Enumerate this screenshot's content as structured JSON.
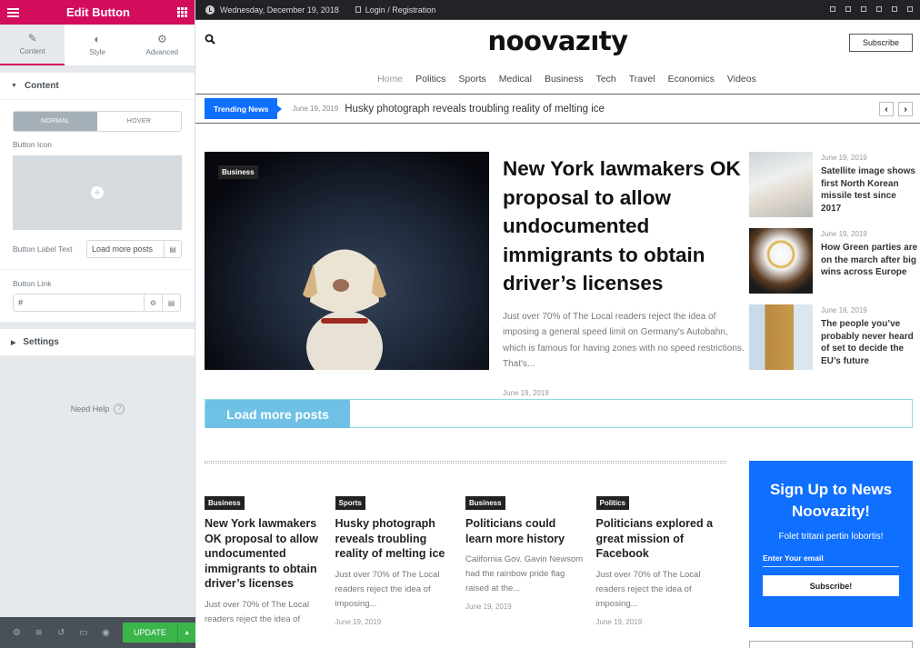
{
  "editor": {
    "title": "Edit Button",
    "tabs": [
      {
        "label": "Content",
        "icon": "pencil-icon",
        "active": true
      },
      {
        "label": "Style",
        "icon": "contrast-icon",
        "active": false
      },
      {
        "label": "Advanced",
        "icon": "gear-icon",
        "active": false
      }
    ],
    "content_section": "Content",
    "state_toggle": {
      "normal": "NORMAL",
      "hover": "HOVER",
      "selected": "NORMAL"
    },
    "button_icon_label": "Button Icon",
    "button_label_text_label": "Button Label Text",
    "button_label_text_value": "Load more posts",
    "button_link_label": "Button Link",
    "button_link_value": "#",
    "settings_section": "Settings",
    "need_help": "Need Help",
    "update_label": "UPDATE"
  },
  "site": {
    "topbar": {
      "date": "Wednesday, December 19, 2018",
      "login": "Login / Registration"
    },
    "logo": "noovazıty",
    "subscribe_label": "Subscribe",
    "nav": [
      "Home",
      "Politics",
      "Sports",
      "Medical",
      "Business",
      "Tech",
      "Travel",
      "Economics",
      "Videos"
    ],
    "trending": {
      "badge": "Trending News",
      "date": "June 19, 2019",
      "title": "Husky photograph reveals troubling reality of melting ice"
    },
    "hero": {
      "category": "Business",
      "title": "New York lawmakers OK proposal to allow undocumented immigrants to obtain driver’s licenses",
      "excerpt": "Just over 70% of The Local readers reject the idea of imposing a general speed limit on Germany's Autobahn, which is famous for having zones with no speed restrictions. That's...",
      "date": "June 19, 2019"
    },
    "side_posts": [
      {
        "date": "June 19, 2019",
        "title": "Satellite image shows first North Korean missile test since 2017"
      },
      {
        "date": "June 19, 2019",
        "title": "How Green parties are on the march after big wins across Europe"
      },
      {
        "date": "June 18, 2019",
        "title": "The people you’ve probably never heard of set to decide the EU’s future"
      }
    ],
    "load_more": "Load more posts",
    "cards": [
      {
        "category": "Business",
        "title": "New York lawmakers OK proposal to allow undocumented immigrants to obtain driver’s licenses",
        "excerpt": "Just over 70% of The Local readers reject the idea of",
        "date": ""
      },
      {
        "category": "Sports",
        "title": "Husky photograph reveals troubling reality of melting ice",
        "excerpt": "Just over 70% of The Local readers reject the idea of imposing...",
        "date": "June 19, 2019"
      },
      {
        "category": "Business",
        "title": "Politicians could learn more history",
        "excerpt": "California Gov. Gavin Newsom had the rainbow pride flag raised at the...",
        "date": "June 19, 2019"
      },
      {
        "category": "Politics",
        "title": "Politicians explored a great mission of Facebook",
        "excerpt": "Just over 70% of The Local readers reject the idea of imposing...",
        "date": "June 19, 2019"
      }
    ],
    "signup": {
      "title": "Sign Up to News Noovazity!",
      "subtitle": "Folet tritani pertin lobortis!",
      "email_placeholder": "Enter Your email",
      "button": "Subscribe!",
      "color": "#0f6fff"
    }
  }
}
